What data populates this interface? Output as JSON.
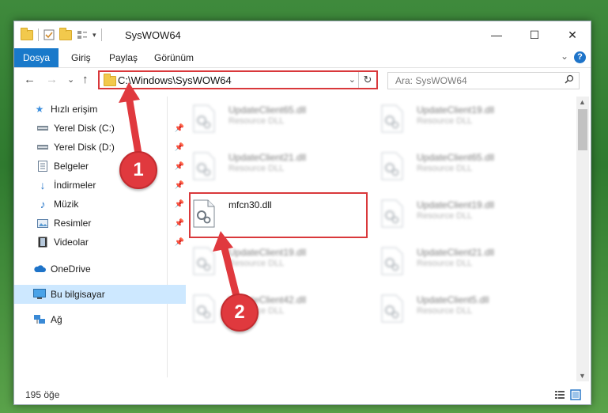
{
  "window": {
    "title": "SysWOW64",
    "minimize_glyph": "—",
    "maximize_glyph": "☐",
    "close_glyph": "✕"
  },
  "ribbon": {
    "tabs": [
      "Dosya",
      "Giriş",
      "Paylaş",
      "Görünüm"
    ],
    "active_tab": "Dosya",
    "help_glyph": "?",
    "expand_glyph": "⌄"
  },
  "nav": {
    "back_glyph": "←",
    "forward_glyph": "→",
    "recent_glyph": "⌄",
    "up_glyph": "↑",
    "address": "C:\\Windows\\SysWOW64",
    "dropdown_glyph": "⌄",
    "refresh_glyph": "↻"
  },
  "search": {
    "placeholder": "Ara: SysWOW64",
    "icon": "search-icon"
  },
  "sidebar": {
    "items": [
      {
        "label": "Hızlı erişim",
        "icon": "star-icon"
      },
      {
        "label": "Yerel Disk (C:)",
        "icon": "drive-icon",
        "pinned": true
      },
      {
        "label": "Yerel Disk (D:)",
        "icon": "drive-icon",
        "pinned": true
      },
      {
        "label": "Belgeler",
        "icon": "documents-icon",
        "pinned": true
      },
      {
        "label": "İndirmeler",
        "icon": "download-icon",
        "pinned": true
      },
      {
        "label": "Müzik",
        "icon": "music-icon",
        "pinned": true
      },
      {
        "label": "Resimler",
        "icon": "pictures-icon",
        "pinned": true
      },
      {
        "label": "Videolar",
        "icon": "videos-icon",
        "pinned": true
      },
      {
        "label": "OneDrive",
        "icon": "cloud-icon"
      },
      {
        "label": "Bu bilgisayar",
        "icon": "computer-icon",
        "selected": true
      },
      {
        "label": "Ağ",
        "icon": "network-icon"
      }
    ]
  },
  "files": [
    {
      "name": "UpdateClient65.dll",
      "desc": "Resource DLL"
    },
    {
      "name": "UpdateClient19.dll",
      "desc": "Resource DLL"
    },
    {
      "name": "UpdateClient21.dll",
      "desc": "Resource DLL"
    },
    {
      "name": "UpdateClient65.dll",
      "desc": "Resource DLL"
    },
    {
      "name": "mfcn30.dll",
      "desc": ""
    },
    {
      "name": "UpdateClient19.dll",
      "desc": "Resource DLL"
    },
    {
      "name": "UpdateClient19.dll",
      "desc": "Resource DLL"
    },
    {
      "name": "UpdateClient21.dll",
      "desc": "Resource DLL"
    },
    {
      "name": "UpdateClient42.dll",
      "desc": "Resource DLL"
    },
    {
      "name": "UpdateClient5.dll",
      "desc": "Resource DLL"
    }
  ],
  "status": {
    "count": "195 öğe"
  },
  "annotations": {
    "step1": "1",
    "step2": "2",
    "color": "#e0393e"
  },
  "colors": {
    "accent": "#1979ca",
    "highlight": "#d9383b",
    "selected_bg": "#cde8ff"
  }
}
